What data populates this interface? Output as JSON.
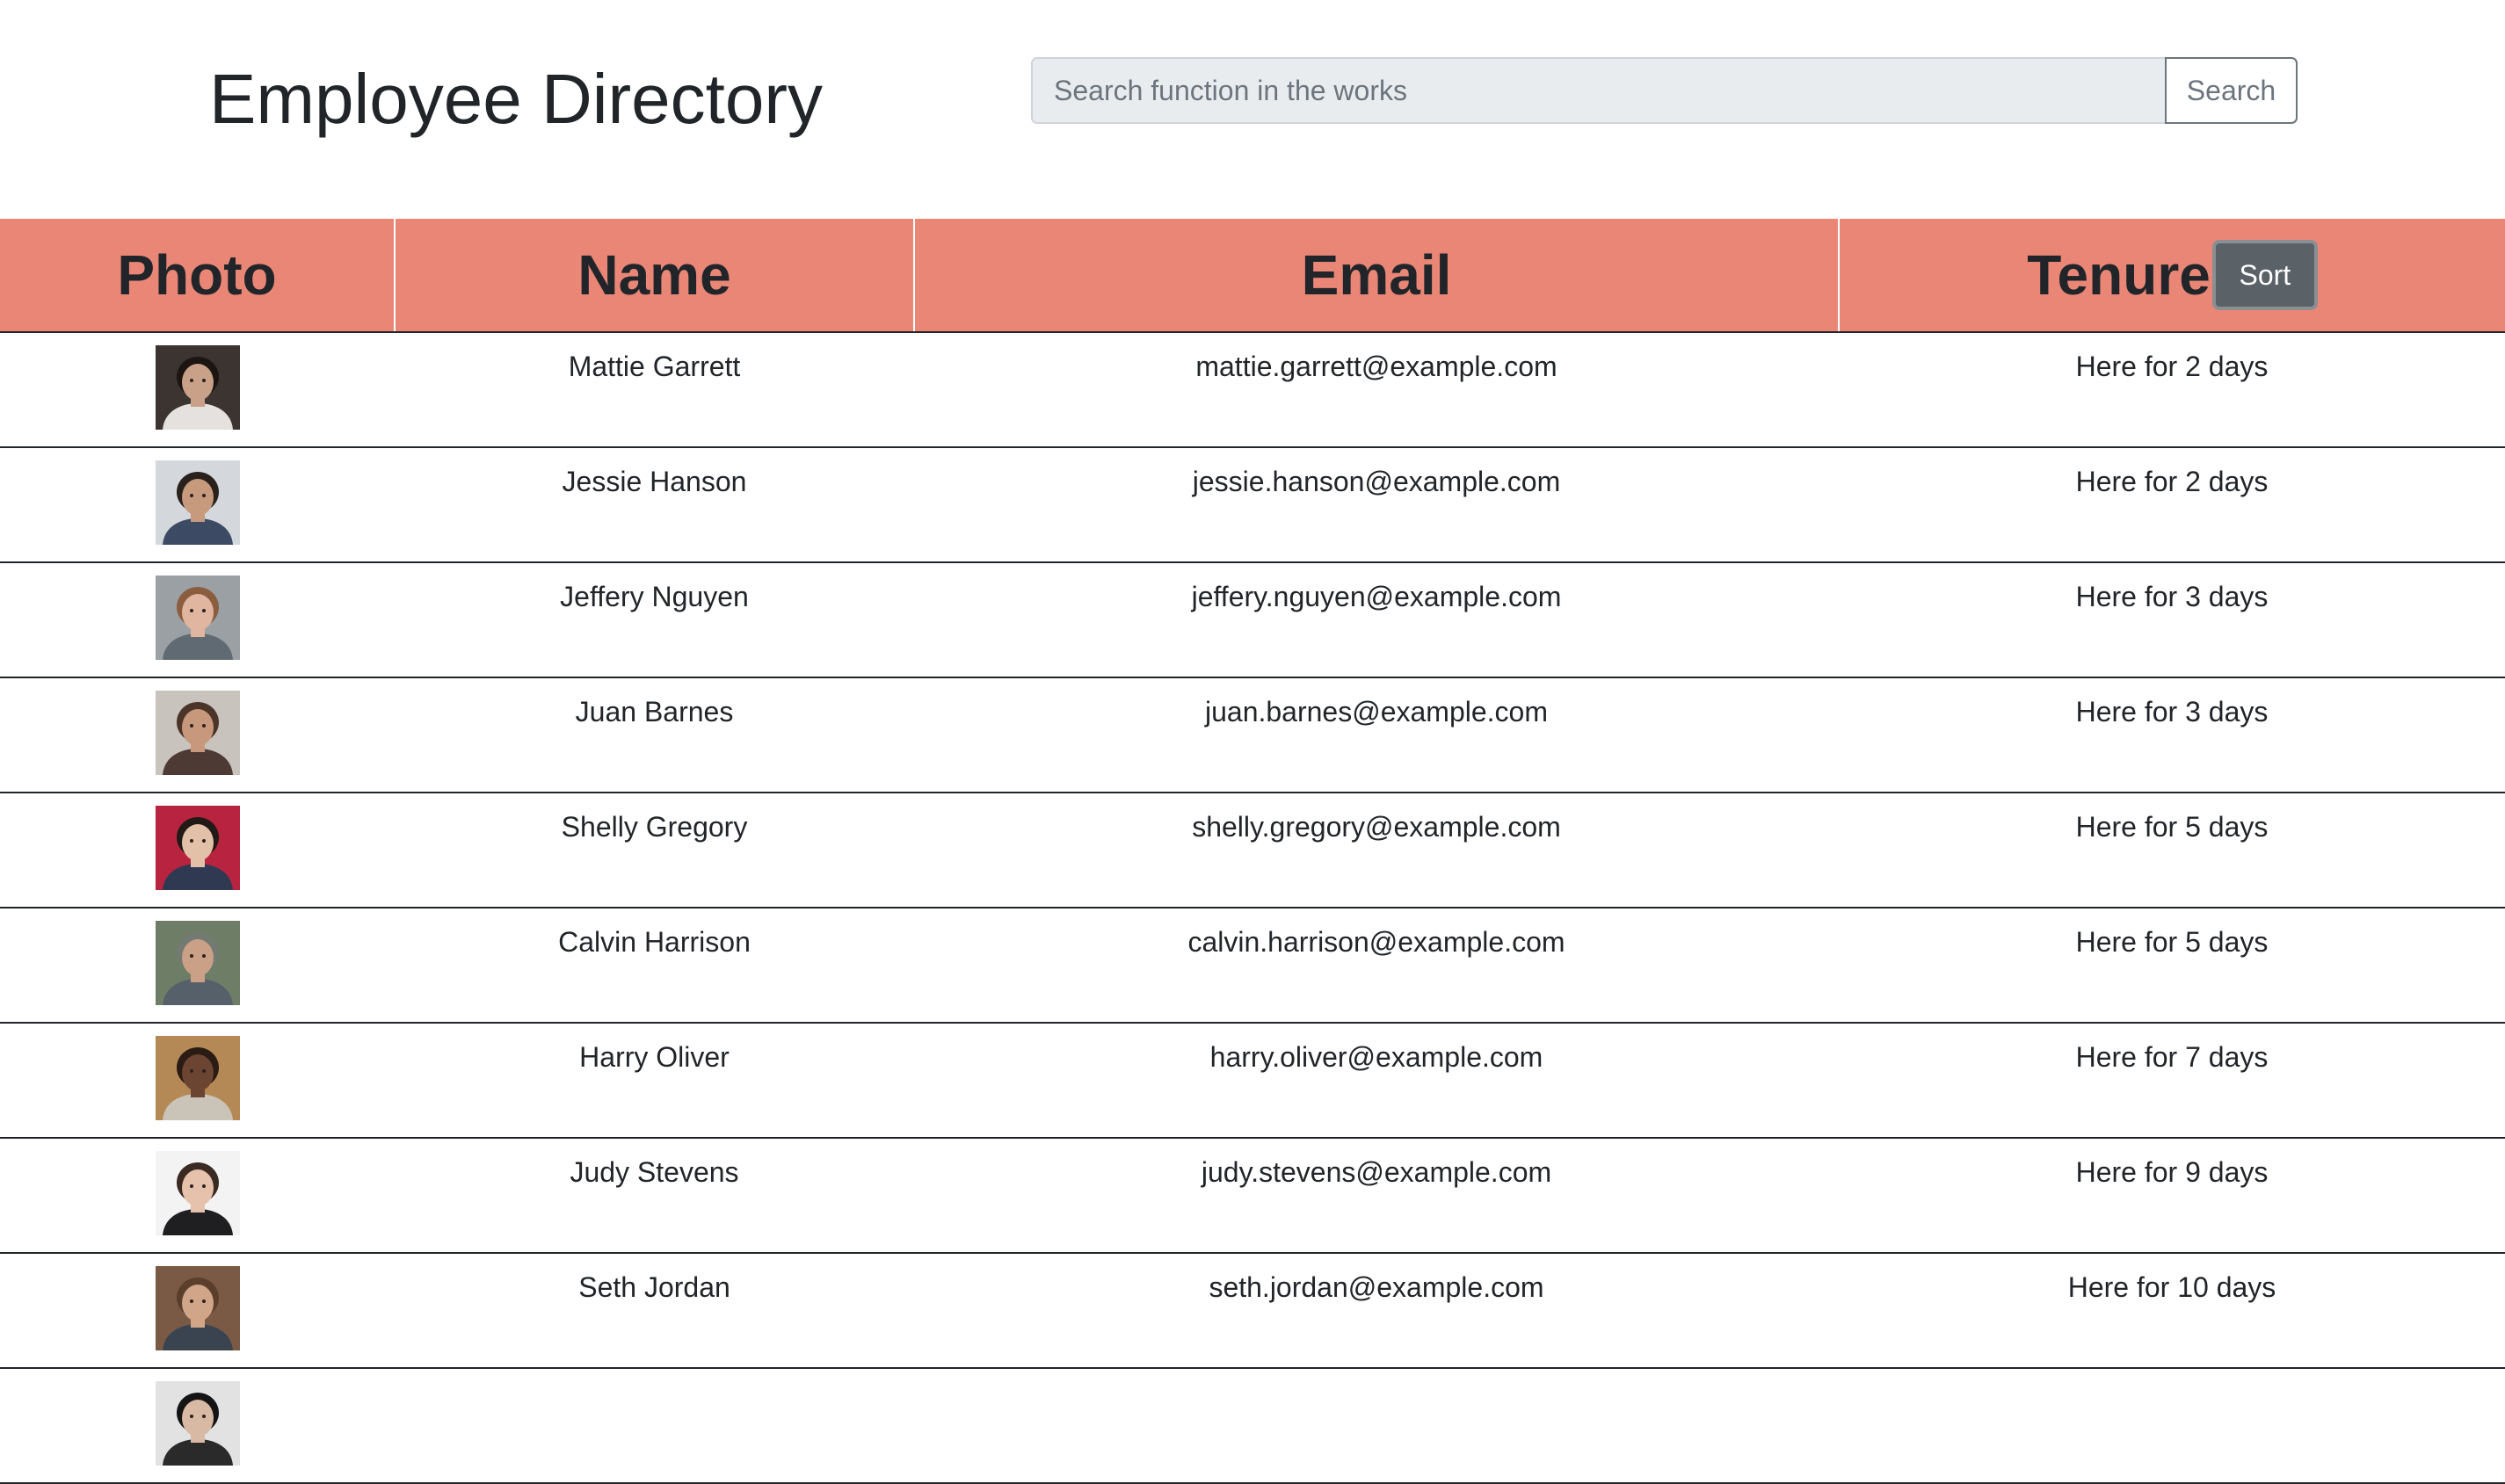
{
  "header": {
    "title": "Employee Directory",
    "search_placeholder": "Search function in the works",
    "search_value": "",
    "search_button": "Search"
  },
  "table": {
    "columns": [
      "Photo",
      "Name",
      "Email",
      "Tenure"
    ],
    "sort_button": "Sort",
    "header_color": "#ea8676",
    "rows": [
      {
        "name": "Mattie Garrett",
        "email": "mattie.garrett@example.com",
        "tenure": "Here for 2 days",
        "photo": {
          "bg": "#3b3430",
          "skin": "#c9a088",
          "hair": "#1c1512",
          "shirt": "#e4e1de"
        }
      },
      {
        "name": "Jessie Hanson",
        "email": "jessie.hanson@example.com",
        "tenure": "Here for 2 days",
        "photo": {
          "bg": "#d4d8dc",
          "skin": "#c79a7e",
          "hair": "#2a211c",
          "shirt": "#3d4a63"
        }
      },
      {
        "name": "Jeffery Nguyen",
        "email": "jeffery.nguyen@example.com",
        "tenure": "Here for 3 days",
        "photo": {
          "bg": "#9aa0a3",
          "skin": "#e0b6a0",
          "hair": "#8a5d3f",
          "shirt": "#5f6a72"
        }
      },
      {
        "name": "Juan Barnes",
        "email": "juan.barnes@example.com",
        "tenure": "Here for 3 days",
        "photo": {
          "bg": "#c8c3bd",
          "skin": "#c8987c",
          "hair": "#4a3528",
          "shirt": "#4d3a34"
        }
      },
      {
        "name": "Shelly Gregory",
        "email": "shelly.gregory@example.com",
        "tenure": "Here for 5 days",
        "photo": {
          "bg": "#b8243f",
          "skin": "#e3c1a8",
          "hair": "#221a17",
          "shirt": "#2f3a52"
        }
      },
      {
        "name": "Calvin Harrison",
        "email": "calvin.harrison@example.com",
        "tenure": "Here for 5 days",
        "photo": {
          "bg": "#6e7e66",
          "skin": "#caa186",
          "hair": "#727a72",
          "shirt": "#55606b"
        }
      },
      {
        "name": "Harry Oliver",
        "email": "harry.oliver@example.com",
        "tenure": "Here for 7 days",
        "photo": {
          "bg": "#b58956",
          "skin": "#6b4532",
          "hair": "#2a1b14",
          "shirt": "#c9c3b8"
        }
      },
      {
        "name": "Judy Stevens",
        "email": "judy.stevens@example.com",
        "tenure": "Here for 9 days",
        "photo": {
          "bg": "#f3f3f3",
          "skin": "#e6c2ad",
          "hair": "#3a2a22",
          "shirt": "#1f1f22"
        }
      },
      {
        "name": "Seth Jordan",
        "email": "seth.jordan@example.com",
        "tenure": "Here for 10 days",
        "photo": {
          "bg": "#7b5a45",
          "skin": "#d1a587",
          "hair": "#5b3f2d",
          "shirt": "#3a4450"
        }
      },
      {
        "name": "",
        "email": "",
        "tenure": "",
        "photo": {
          "bg": "#e2e2e2",
          "skin": "#d8b9a3",
          "hair": "#141414",
          "shirt": "#2a2a2a"
        }
      }
    ]
  }
}
